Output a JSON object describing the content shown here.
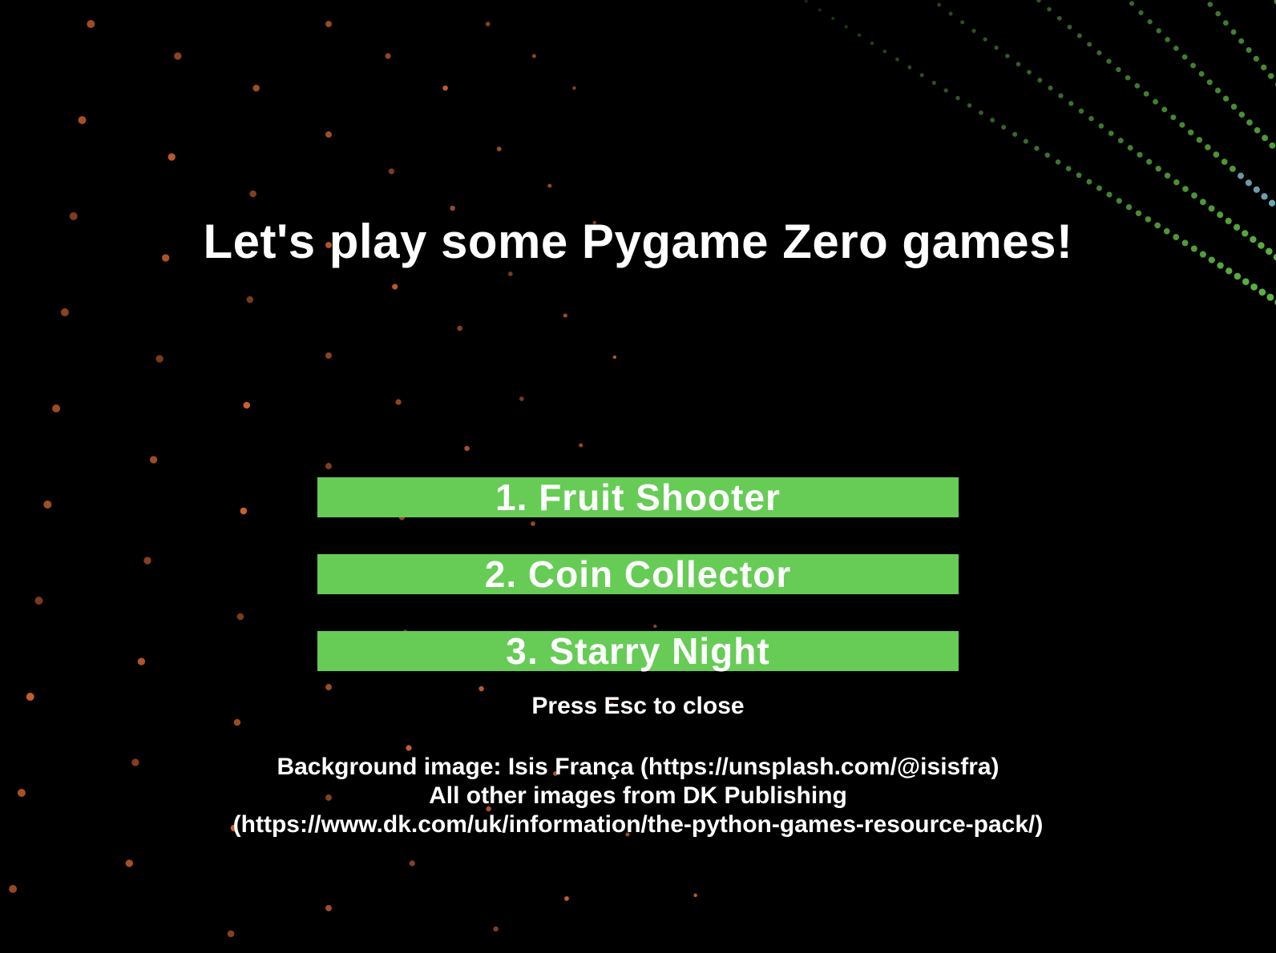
{
  "title": "Let's play some Pygame Zero games!",
  "menu": {
    "items": [
      {
        "label": "1. Fruit Shooter"
      },
      {
        "label": "2. Coin Collector"
      },
      {
        "label": "3. Starry Night"
      }
    ],
    "button_color": "#66cc55"
  },
  "hint": "Press Esc to close",
  "credits": {
    "line1": "Background image: Isis França (https://unsplash.com/@isisfra)",
    "line2": "All other images from DK Publishing",
    "line3": "(https://www.dk.com/uk/information/the-python-games-resource-pack/)"
  },
  "background": {
    "icon": "light-dots-background",
    "colors": {
      "base": "#000000",
      "warm_dots": "#ff7a3c",
      "cool_dots": "#7cf05a",
      "cyan_dots": "#9ff0ff"
    }
  }
}
